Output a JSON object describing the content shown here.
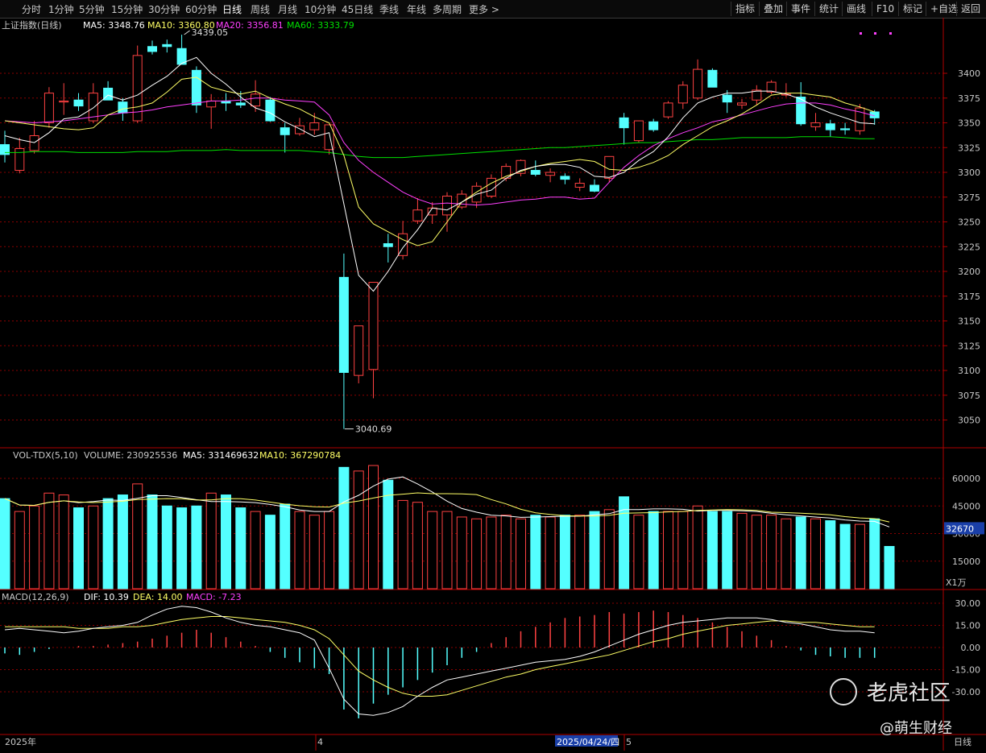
{
  "toolbar": {
    "tabs": [
      "分时",
      "1分钟",
      "5分钟",
      "15分钟",
      "30分钟",
      "60分钟",
      "日线",
      "周线",
      "月线",
      "10分钟",
      "45日线",
      "季线",
      "年线",
      "多周期",
      "更多 >"
    ],
    "active_tab": "日线",
    "right_buttons": [
      "指标",
      "叠加",
      "事件",
      "统计",
      "画线",
      "F10",
      "标记",
      "+自选",
      "返回"
    ]
  },
  "price_panel": {
    "title": "上证指数(日线)",
    "ma5": "MA5: 3348.76",
    "ma10": "MA10: 3360.80",
    "ma20": "MA20: 3356.81",
    "ma60": "MA60: 3333.79",
    "high_label": "3439.05",
    "low_label": "3040.69",
    "y_ticks": [
      "3400",
      "3375",
      "3350",
      "3325",
      "3300",
      "3275",
      "3250",
      "3225",
      "3200",
      "3175",
      "3150",
      "3125",
      "3100",
      "3075",
      "3050"
    ]
  },
  "volume_panel": {
    "title": "VOL-TDX(5,10)",
    "volume": "VOLUME: 230925536",
    "ma5": "MA5: 331469632",
    "ma10": "MA10: 367290784",
    "y_ticks": [
      "60000",
      "45000",
      "30000",
      "15000"
    ],
    "current": "32670",
    "unit": "X1万"
  },
  "macd_panel": {
    "title": "MACD(12,26,9)",
    "dif": "DIF: 10.39",
    "dea": "DEA: 14.00",
    "macd": "MACD: -7.23",
    "y_ticks": [
      "30.00",
      "15.00",
      "0.00",
      "-15.00",
      "-30.00"
    ]
  },
  "x_axis": {
    "labels": [
      "2025年",
      "4",
      "2025/04/24/四",
      "5"
    ],
    "period": "日线"
  },
  "watermark": {
    "brand": "老虎社区",
    "author": "@萌生财经"
  },
  "colors": {
    "up": "#ff4242",
    "down": "#54ffff",
    "ma5": "#ffffff",
    "ma10": "#ffff66",
    "ma20": "#ff40ff",
    "ma60": "#00e000",
    "grid": "#8a0000",
    "panel_border": "#b00000"
  },
  "chart_data": {
    "type": "candlestick",
    "title": "上证指数(日线)",
    "candles": [
      {
        "o": 3328,
        "h": 3342,
        "l": 3310,
        "c": 3318
      },
      {
        "o": 3302,
        "h": 3335,
        "l": 3299,
        "c": 3324
      },
      {
        "o": 3322,
        "h": 3352,
        "l": 3319,
        "c": 3337
      },
      {
        "o": 3350,
        "h": 3386,
        "l": 3345,
        "c": 3380
      },
      {
        "o": 3371,
        "h": 3390,
        "l": 3358,
        "c": 3372
      },
      {
        "o": 3373,
        "h": 3380,
        "l": 3362,
        "c": 3367
      },
      {
        "o": 3352,
        "h": 3390,
        "l": 3350,
        "c": 3380
      },
      {
        "o": 3385,
        "h": 3392,
        "l": 3373,
        "c": 3373
      },
      {
        "o": 3371,
        "h": 3375,
        "l": 3352,
        "c": 3360
      },
      {
        "o": 3352,
        "h": 3428,
        "l": 3350,
        "c": 3418
      },
      {
        "o": 3427,
        "h": 3433,
        "l": 3419,
        "c": 3422
      },
      {
        "o": 3429,
        "h": 3434,
        "l": 3421,
        "c": 3427
      },
      {
        "o": 3425,
        "h": 3439,
        "l": 3413,
        "c": 3409
      },
      {
        "o": 3403,
        "h": 3407,
        "l": 3360,
        "c": 3368
      },
      {
        "o": 3366,
        "h": 3379,
        "l": 3344,
        "c": 3372
      },
      {
        "o": 3372,
        "h": 3380,
        "l": 3362,
        "c": 3370
      },
      {
        "o": 3370,
        "h": 3382,
        "l": 3365,
        "c": 3368
      },
      {
        "o": 3367,
        "h": 3393,
        "l": 3361,
        "c": 3379
      },
      {
        "o": 3373,
        "h": 3376,
        "l": 3351,
        "c": 3352
      },
      {
        "o": 3345,
        "h": 3350,
        "l": 3320,
        "c": 3338
      },
      {
        "o": 3339,
        "h": 3355,
        "l": 3337,
        "c": 3347
      },
      {
        "o": 3343,
        "h": 3360,
        "l": 3338,
        "c": 3350
      },
      {
        "o": 3323,
        "h": 3348,
        "l": 3318,
        "c": 3348
      },
      {
        "o": 3194,
        "h": 3218,
        "l": 3041,
        "c": 3098
      },
      {
        "o": 3095,
        "h": 3145,
        "l": 3087,
        "c": 3145
      },
      {
        "o": 3101,
        "h": 3189,
        "l": 3072,
        "c": 3189
      },
      {
        "o": 3228,
        "h": 3238,
        "l": 3209,
        "c": 3225
      },
      {
        "o": 3216,
        "h": 3251,
        "l": 3212,
        "c": 3238
      },
      {
        "o": 3251,
        "h": 3274,
        "l": 3248,
        "c": 3262
      },
      {
        "o": 3257,
        "h": 3270,
        "l": 3248,
        "c": 3264
      },
      {
        "o": 3257,
        "h": 3280,
        "l": 3240,
        "c": 3276
      },
      {
        "o": 3265,
        "h": 3282,
        "l": 3263,
        "c": 3278
      },
      {
        "o": 3270,
        "h": 3290,
        "l": 3264,
        "c": 3286
      },
      {
        "o": 3276,
        "h": 3298,
        "l": 3274,
        "c": 3294
      },
      {
        "o": 3294,
        "h": 3309,
        "l": 3291,
        "c": 3306
      },
      {
        "o": 3299,
        "h": 3313,
        "l": 3296,
        "c": 3312
      },
      {
        "o": 3302,
        "h": 3312,
        "l": 3296,
        "c": 3298
      },
      {
        "o": 3297,
        "h": 3304,
        "l": 3290,
        "c": 3300
      },
      {
        "o": 3296,
        "h": 3299,
        "l": 3288,
        "c": 3293
      },
      {
        "o": 3285,
        "h": 3294,
        "l": 3281,
        "c": 3289
      },
      {
        "o": 3287,
        "h": 3293,
        "l": 3280,
        "c": 3281
      },
      {
        "o": 3294,
        "h": 3316,
        "l": 3290,
        "c": 3316
      },
      {
        "o": 3355,
        "h": 3360,
        "l": 3328,
        "c": 3345
      },
      {
        "o": 3332,
        "h": 3352,
        "l": 3330,
        "c": 3352
      },
      {
        "o": 3351,
        "h": 3354,
        "l": 3341,
        "c": 3343
      },
      {
        "o": 3356,
        "h": 3372,
        "l": 3354,
        "c": 3370
      },
      {
        "o": 3370,
        "h": 3392,
        "l": 3364,
        "c": 3388
      },
      {
        "o": 3375,
        "h": 3414,
        "l": 3373,
        "c": 3404
      },
      {
        "o": 3403,
        "h": 3405,
        "l": 3386,
        "c": 3386
      },
      {
        "o": 3378,
        "h": 3383,
        "l": 3360,
        "c": 3371
      },
      {
        "o": 3368,
        "h": 3374,
        "l": 3364,
        "c": 3370
      },
      {
        "o": 3373,
        "h": 3388,
        "l": 3368,
        "c": 3383
      },
      {
        "o": 3381,
        "h": 3393,
        "l": 3379,
        "c": 3391
      },
      {
        "o": 3378,
        "h": 3390,
        "l": 3376,
        "c": 3379
      },
      {
        "o": 3376,
        "h": 3391,
        "l": 3347,
        "c": 3349
      },
      {
        "o": 3346,
        "h": 3360,
        "l": 3342,
        "c": 3350
      },
      {
        "o": 3349,
        "h": 3353,
        "l": 3336,
        "c": 3343
      },
      {
        "o": 3344,
        "h": 3350,
        "l": 3338,
        "c": 3343
      },
      {
        "o": 3342,
        "h": 3369,
        "l": 3338,
        "c": 3365
      },
      {
        "o": 3361,
        "h": 3363,
        "l": 3348,
        "c": 3355
      }
    ],
    "ma5": [
      3337,
      3333,
      3330,
      3340,
      3354,
      3356,
      3365,
      3378,
      3373,
      3378,
      3388,
      3397,
      3410,
      3416,
      3400,
      3389,
      3376,
      3365,
      3360,
      3351,
      3344,
      3336,
      3340,
      3268,
      3196,
      3180,
      3200,
      3224,
      3242,
      3264,
      3262,
      3270,
      3278,
      3282,
      3294,
      3302,
      3306,
      3308,
      3308,
      3305,
      3296,
      3295,
      3300,
      3312,
      3321,
      3336,
      3355,
      3370,
      3376,
      3380,
      3380,
      3382,
      3382,
      3379,
      3374,
      3366,
      3360,
      3355,
      3350,
      3349
    ],
    "ma10": [
      3352,
      3350,
      3348,
      3346,
      3344,
      3343,
      3345,
      3358,
      3364,
      3366,
      3370,
      3381,
      3394,
      3396,
      3386,
      3382,
      3379,
      3382,
      3375,
      3369,
      3364,
      3356,
      3350,
      3317,
      3265,
      3248,
      3240,
      3232,
      3226,
      3230,
      3250,
      3270,
      3280,
      3289,
      3296,
      3301,
      3306,
      3309,
      3311,
      3313,
      3311,
      3303,
      3302,
      3305,
      3310,
      3317,
      3328,
      3337,
      3346,
      3352,
      3359,
      3368,
      3378,
      3380,
      3380,
      3378,
      3376,
      3370,
      3366,
      3361
    ],
    "ma20": [
      3352,
      3351,
      3350,
      3351,
      3352,
      3354,
      3356,
      3358,
      3360,
      3361,
      3363,
      3366,
      3368,
      3370,
      3372,
      3372,
      3373,
      3375,
      3375,
      3373,
      3372,
      3371,
      3358,
      3330,
      3312,
      3300,
      3290,
      3280,
      3273,
      3268,
      3269,
      3268,
      3267,
      3268,
      3270,
      3272,
      3273,
      3275,
      3275,
      3273,
      3274,
      3290,
      3305,
      3317,
      3327,
      3334,
      3340,
      3345,
      3351,
      3354,
      3358,
      3362,
      3366,
      3369,
      3370,
      3370,
      3368,
      3364,
      3361,
      3357
    ],
    "ma60": [
      3320,
      3320,
      3321,
      3321,
      3321,
      3320,
      3320,
      3320,
      3320,
      3321,
      3321,
      3321,
      3322,
      3322,
      3322,
      3323,
      3322,
      3322,
      3322,
      3322,
      3322,
      3321,
      3320,
      3318,
      3316,
      3315,
      3315,
      3315,
      3316,
      3317,
      3318,
      3319,
      3320,
      3321,
      3322,
      3323,
      3324,
      3325,
      3325,
      3326,
      3327,
      3328,
      3329,
      3330,
      3330,
      3331,
      3332,
      3333,
      3333,
      3334,
      3335,
      3335,
      3335,
      3335,
      3336,
      3336,
      3336,
      3335,
      3334,
      3334
    ],
    "volume": [
      49000,
      42000,
      45000,
      52000,
      51000,
      44000,
      45000,
      49000,
      51000,
      57000,
      51000,
      45000,
      44000,
      45000,
      52000,
      51000,
      44000,
      42000,
      40000,
      46000,
      42000,
      40000,
      42000,
      66000,
      64000,
      67000,
      59000,
      48000,
      47000,
      42000,
      42000,
      39000,
      38000,
      39000,
      40000,
      38000,
      40000,
      39000,
      40000,
      40000,
      42000,
      43000,
      50000,
      40000,
      42000,
      42000,
      42000,
      45000,
      42000,
      42000,
      41000,
      40000,
      40000,
      38000,
      39000,
      38000,
      37000,
      35000,
      35000,
      38000,
      23000
    ],
    "macd_hist": [
      -4,
      -5,
      -3,
      -1,
      0,
      1,
      1,
      2,
      3,
      4,
      6,
      8,
      10,
      12,
      10,
      7,
      4,
      1,
      -3,
      -7,
      -10,
      -14,
      -18,
      -42,
      -48,
      -38,
      -32,
      -27,
      -22,
      -17,
      -12,
      -7,
      -3,
      3,
      7,
      11,
      14,
      17,
      20,
      21,
      22,
      24,
      23,
      24,
      25,
      24,
      22,
      20,
      17,
      14,
      11,
      8,
      5,
      1,
      -2,
      -5,
      -6,
      -7,
      -7,
      -7
    ],
    "dif": [
      12,
      13,
      12,
      11,
      10,
      11,
      13,
      14,
      15,
      17,
      22,
      26,
      28,
      27,
      24,
      20,
      17,
      15,
      14,
      12,
      10,
      5,
      -14,
      -35,
      -45,
      -46,
      -44,
      -40,
      -33,
      -27,
      -22,
      -20,
      -18,
      -16,
      -14,
      -12,
      -10,
      -9,
      -8,
      -6,
      -3,
      1,
      5,
      9,
      12,
      15,
      17,
      18,
      19,
      20,
      20,
      20,
      19,
      17,
      16,
      14,
      12,
      11,
      11,
      10
    ],
    "dea": [
      14,
      14,
      14,
      14,
      14,
      13,
      13,
      13,
      14,
      14,
      15,
      17,
      19,
      20,
      21,
      21,
      20,
      19,
      18,
      17,
      15,
      12,
      6,
      -5,
      -16,
      -22,
      -27,
      -31,
      -33,
      -33,
      -32,
      -29,
      -26,
      -23,
      -20,
      -18,
      -15,
      -13,
      -11,
      -9,
      -7,
      -5,
      -2,
      1,
      4,
      6,
      9,
      11,
      13,
      15,
      16,
      17,
      18,
      18,
      17,
      17,
      16,
      15,
      14,
      14
    ]
  }
}
